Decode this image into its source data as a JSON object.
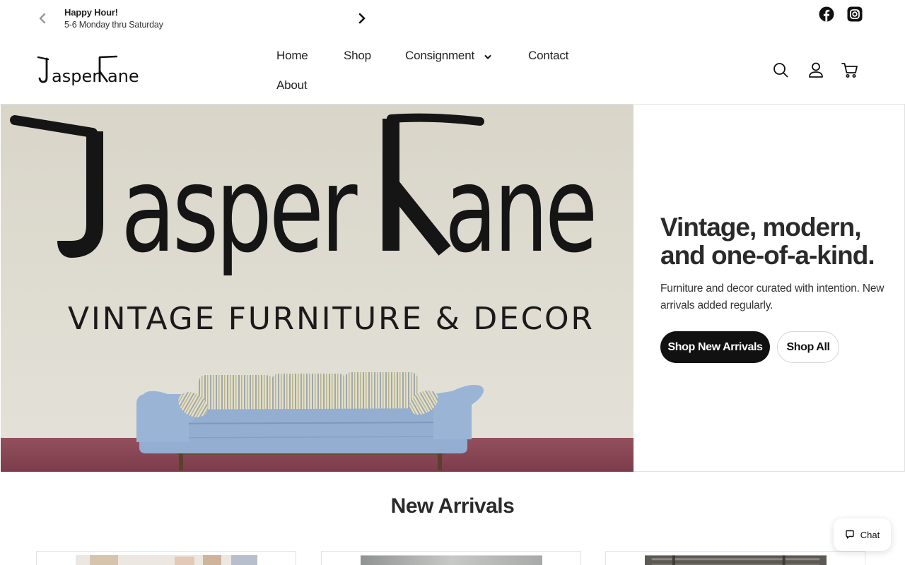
{
  "announcement": {
    "title": "Happy Hour!",
    "subtitle": "5-6 Monday thru Saturday"
  },
  "social": {
    "facebook": "facebook-icon",
    "instagram": "instagram-icon"
  },
  "header": {
    "logo_text": "Jasper Kane",
    "nav": [
      {
        "label": "Home"
      },
      {
        "label": "Shop"
      },
      {
        "label": "Consignment",
        "has_dropdown": true
      },
      {
        "label": "Contact"
      },
      {
        "label": "About"
      }
    ],
    "icons": [
      "search-icon",
      "account-icon",
      "cart-icon"
    ]
  },
  "hero": {
    "image_logo_text": "Jasper Kane",
    "image_tagline": "VINTAGE FURNITURE & DECOR",
    "heading": "Vintage, modern, and one-of-a-kind.",
    "text": "Furniture and decor curated with intention. New arrivals added regularly.",
    "primary_button": "Shop New Arrivals",
    "secondary_button": "Shop All"
  },
  "new_arrivals": {
    "title": "New Arrivals"
  },
  "chat": {
    "label": "Chat"
  },
  "colors": {
    "primary": "#111111",
    "text": "#222222",
    "border": "#e2e2e2",
    "sofa": "#93aed1",
    "floor": "#8a4654",
    "wall": "#dcd8cc"
  }
}
